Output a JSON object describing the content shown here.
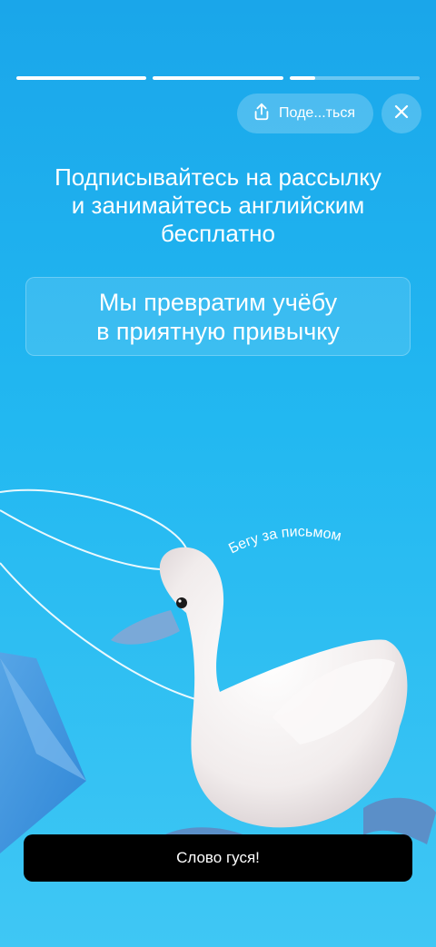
{
  "story": {
    "progress": [
      1,
      1,
      0.2
    ]
  },
  "topbar": {
    "share_label": "Поде...ться",
    "share_icon": "share-icon",
    "close_icon": "close-icon"
  },
  "headline": "Подписывайтесь на рассылку\nи занимайтесь английским\nбесплатно",
  "card_text": "Мы превратим учёбу\nв приятную привычку",
  "illustration": {
    "caption": "Бегу за письмом"
  },
  "cta_label": "Слово гуся!"
}
